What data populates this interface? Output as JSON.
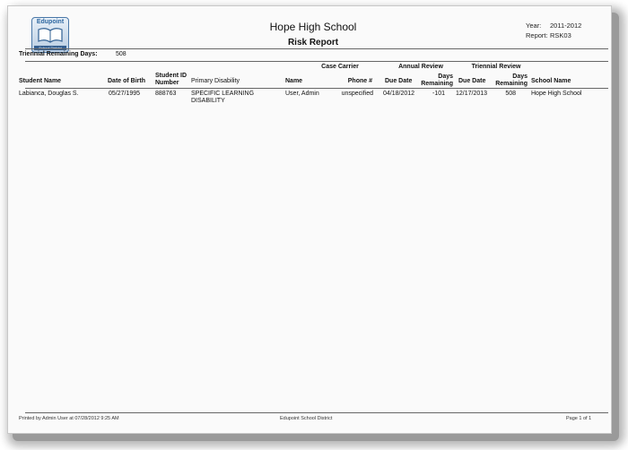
{
  "header": {
    "logo_text": "Edupoint",
    "logo_subtext": "School District",
    "school_name": "Hope High School",
    "report_name": "Risk Report",
    "year_label": "Year:",
    "year_value": "2011-2012",
    "report_label": "Report:",
    "report_value": "RSK03"
  },
  "filter": {
    "label": "Triennial Remaining Days:",
    "value": "508"
  },
  "table": {
    "group_headers": {
      "case_carrier": "Case Carrier",
      "annual_review": "Annual Review",
      "triennial_review": "Triennial Review"
    },
    "columns": {
      "student_name": "Student Name",
      "dob": "Date of Birth",
      "student_id_1": "Student ID",
      "student_id_2": "Number",
      "primary_disability": "Primary Disability",
      "cc_name": "Name",
      "cc_phone": "Phone #",
      "ar_due": "Due Date",
      "ar_days_1": "Days",
      "ar_days_2": "Remaining",
      "tr_due": "Due Date",
      "tr_days_1": "Days",
      "tr_days_2": "Remaining",
      "school_name": "School Name"
    },
    "rows": [
      {
        "student_name": "Labianca, Douglas S.",
        "dob": "05/27/1995",
        "student_id": "888763",
        "disability_1": "SPECIFIC LEARNING",
        "disability_2": "DISABILITY",
        "cc_name": "User, Admin",
        "cc_phone": "unspecified",
        "ar_due": "04/18/2012",
        "ar_days": "-101",
        "tr_due": "12/17/2013",
        "tr_days": "508",
        "school": "Hope High School"
      }
    ]
  },
  "footer": {
    "printed_by": "Printed by Admin User at 07/28/2012 9:25 AM",
    "district": "Edupoint School District",
    "page": "Page 1 of 1"
  }
}
